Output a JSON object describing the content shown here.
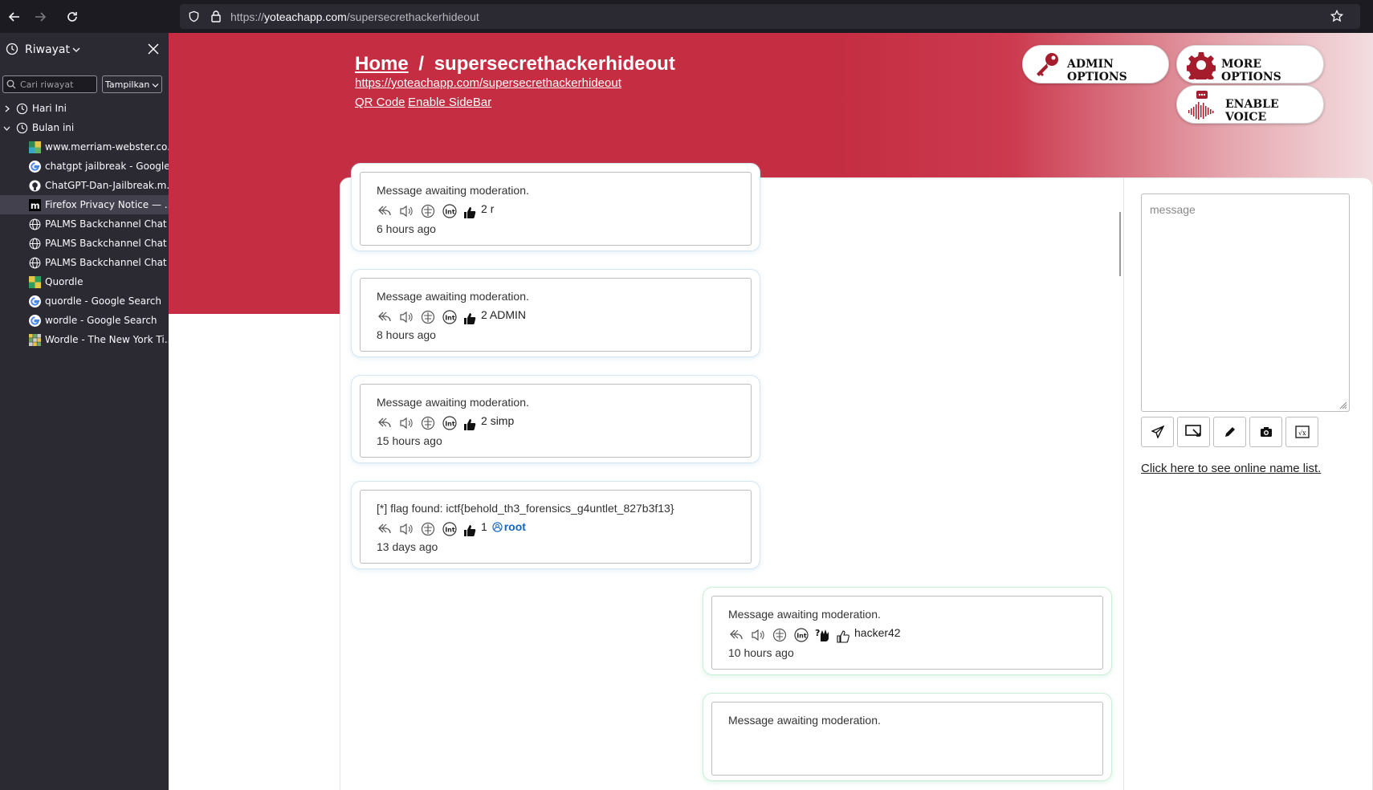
{
  "browser": {
    "url_prefix": "https://",
    "url_domain": "yoteachapp.com",
    "url_path": "/supersecrethackerhideout"
  },
  "sidebar": {
    "title": "Riwayat",
    "search_placeholder": "Cari riwayat",
    "view_label": "Tampilkan",
    "groups": [
      {
        "label": "Hari Ini",
        "expanded": false
      },
      {
        "label": "Bulan ini",
        "expanded": true
      }
    ],
    "items": [
      {
        "label": "www.merriam-webster.co...",
        "icon": "merriam-webster-favicon"
      },
      {
        "label": "chatgpt jailbreak - Google ...",
        "icon": "google-favicon"
      },
      {
        "label": "ChatGPT-Dan-Jailbreak.m...",
        "icon": "github-favicon"
      },
      {
        "label": "Firefox Privacy Notice — ...",
        "icon": "mozilla-favicon"
      },
      {
        "label": "PALMS Backchannel Chat ...",
        "icon": "globe-icon"
      },
      {
        "label": "PALMS Backchannel Chat ...",
        "icon": "globe-icon"
      },
      {
        "label": "PALMS Backchannel Chat ...",
        "icon": "globe-icon"
      },
      {
        "label": "Quordle",
        "icon": "quordle-favicon"
      },
      {
        "label": "quordle - Google Search",
        "icon": "google-favicon"
      },
      {
        "label": "wordle - Google Search",
        "icon": "google-favicon"
      },
      {
        "label": "Wordle - The New York Ti...",
        "icon": "wordle-favicon"
      }
    ]
  },
  "header": {
    "home": "Home",
    "separator": "/",
    "room": "supersecrethackerhideout",
    "room_url": "https://yoteachapp.com/supersecrethackerhideout",
    "qr_code": "QR Code",
    "enable_sidebar": "Enable SideBar",
    "admin_options": "ADMIN OPTIONS",
    "more_options": "MORE OPTIONS",
    "enable_voice": "ENABLE VOICE"
  },
  "messages": [
    {
      "text": "Message awaiting moderation.",
      "votes": "2",
      "user": "r",
      "time": "6 hours ago",
      "mine": false,
      "user_icon": false
    },
    {
      "text": "Message awaiting moderation.",
      "votes": "2",
      "user": "ADMIN",
      "time": "8 hours ago",
      "mine": false,
      "user_icon": false
    },
    {
      "text": "Message awaiting moderation.",
      "votes": "2",
      "user": "simp",
      "time": "15 hours ago",
      "mine": false,
      "user_icon": false
    },
    {
      "text": "[*] flag found: ictf{behold_th3_forensics_g4untlet_827b3f13}",
      "votes": "1",
      "user": "root",
      "time": "13 days ago",
      "mine": false,
      "user_icon": true
    },
    {
      "text": "Message awaiting moderation.",
      "votes": "",
      "user": "hacker42",
      "time": "10 hours ago",
      "mine": true,
      "user_icon": false
    },
    {
      "text": "Message awaiting moderation.",
      "votes": "",
      "user": "",
      "time": "",
      "mine": true,
      "user_icon": false
    }
  ],
  "compose": {
    "placeholder": "message",
    "online_link": "Click here to see online name list."
  },
  "colors": {
    "brand_red": "#c42d42",
    "admin_key": "#a51d2d"
  }
}
